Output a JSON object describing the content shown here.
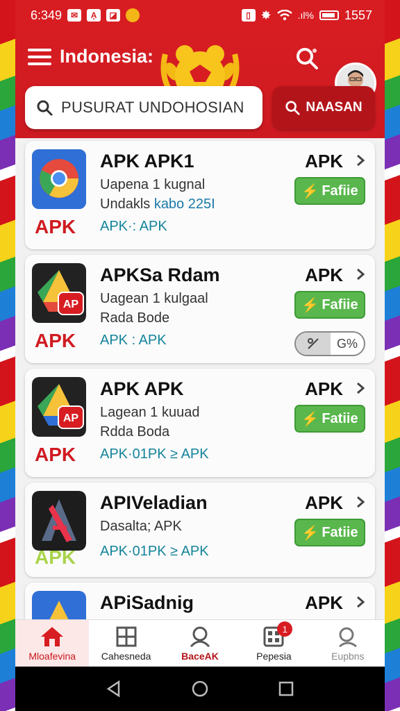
{
  "status_bar": {
    "time": "6:349",
    "battery_text": "1557"
  },
  "header": {
    "title": "Indonesia:",
    "search_placeholder": "PUSURAT UNDOHOSIAN",
    "search_button_label": "NAASAN"
  },
  "apps": [
    {
      "name": "APK APK1",
      "line1": "Uapena 1 kugnal",
      "line2_prefix": "Undakls ",
      "line2_highlight": "kabo 225I",
      "tag": "APK·: APK",
      "apk_label": "APK",
      "badge": "APK",
      "button": "Fafiie",
      "icon": "chrome-like-icon"
    },
    {
      "name": "APKSa Rdam",
      "line1": "Uagean 1 kulgaal",
      "line2_prefix": "Rada Bode",
      "line2_highlight": "",
      "tag": "APK : APK",
      "apk_label": "APK",
      "badge": "APK",
      "button": "Fafiie",
      "toggle_value": "G%",
      "icon": "drive-ap-icon"
    },
    {
      "name": "APK APK",
      "line1": "Lagean 1 kuuad",
      "line2_prefix": "Rdda Boda",
      "line2_highlight": "",
      "tag": "APK·01PK ≥ APK",
      "apk_label": "APK",
      "badge": "APK",
      "button": "Fatiie",
      "icon": "drive-ap-icon"
    },
    {
      "name": "APIVeladian",
      "line1": "Dasalta; APK",
      "line2_prefix": "",
      "line2_highlight": "",
      "tag": "APK·01PK ≥ APK",
      "apk_label": "APK",
      "badge": "APK",
      "button": "Fatiie",
      "icon": "a-tool-icon"
    },
    {
      "name": "APiSadnig",
      "line1": "",
      "line2_prefix": "",
      "line2_highlight": "",
      "tag": "",
      "apk_label": "APK",
      "badge": "",
      "button": "",
      "icon": "drive-icon"
    }
  ],
  "bottom_nav": [
    {
      "label": "Mloafеvina",
      "icon": "home-icon"
    },
    {
      "label": "Cahesneda",
      "icon": "grid-icon"
    },
    {
      "label": "BaceAK",
      "icon": "person-search-icon"
    },
    {
      "label": "Pepesia",
      "icon": "apps-icon",
      "badge": "1"
    },
    {
      "label": "Eupbns",
      "icon": "search-icon"
    }
  ],
  "colors": {
    "primary_red": "#d71d22",
    "install_green": "#5ab74e",
    "tag_teal": "#14849a"
  }
}
